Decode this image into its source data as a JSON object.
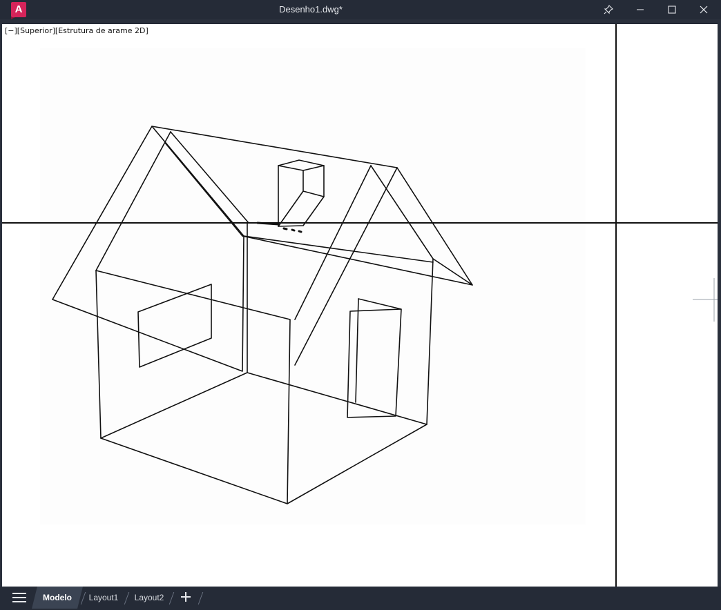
{
  "window": {
    "title": "Desenho1.dwg*",
    "logo_letter": "A",
    "controls": [
      "pin-icon",
      "minimize-icon",
      "maximize-icon",
      "close-icon"
    ]
  },
  "viewport": {
    "label": "[−][Superior][Estrutura de arame 2D]"
  },
  "layout_tabs": [
    {
      "label": "Modelo",
      "active": true
    },
    {
      "label": "Layout1",
      "active": false
    },
    {
      "label": "Layout2",
      "active": false
    }
  ],
  "colors": {
    "brand": "#d6245a",
    "chrome": "#252b37",
    "canvas": "#ffffff",
    "lines": "#111111"
  }
}
